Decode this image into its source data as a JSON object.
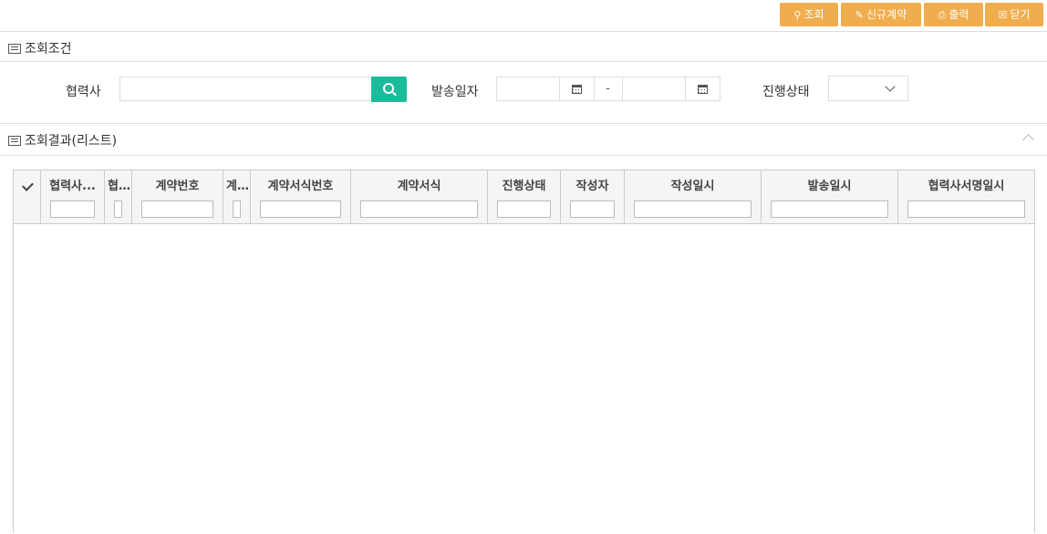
{
  "toolbar": {
    "search_label": "조회",
    "new_contract_label": "신규계약",
    "print_label": "출력",
    "close_label": "닫기"
  },
  "search_section": {
    "title": "조회조건",
    "partner_label": "협력사",
    "partner_value": "",
    "send_date_label": "발송일자",
    "date_from": "",
    "date_separator": "-",
    "date_to": "",
    "status_label": "진행상태",
    "status_value": ""
  },
  "result_section": {
    "title": "조회결과(리스트)"
  },
  "grid": {
    "columns": [
      "협력사...",
      "협...",
      "계약번호",
      "계...",
      "계약서식번호",
      "계약서식",
      "진행상태",
      "작성자",
      "작성일시",
      "발송일시",
      "협력사서명일시"
    ],
    "rows": []
  },
  "colors": {
    "button": "#f0ad4e",
    "search_button": "#1abc9c"
  }
}
